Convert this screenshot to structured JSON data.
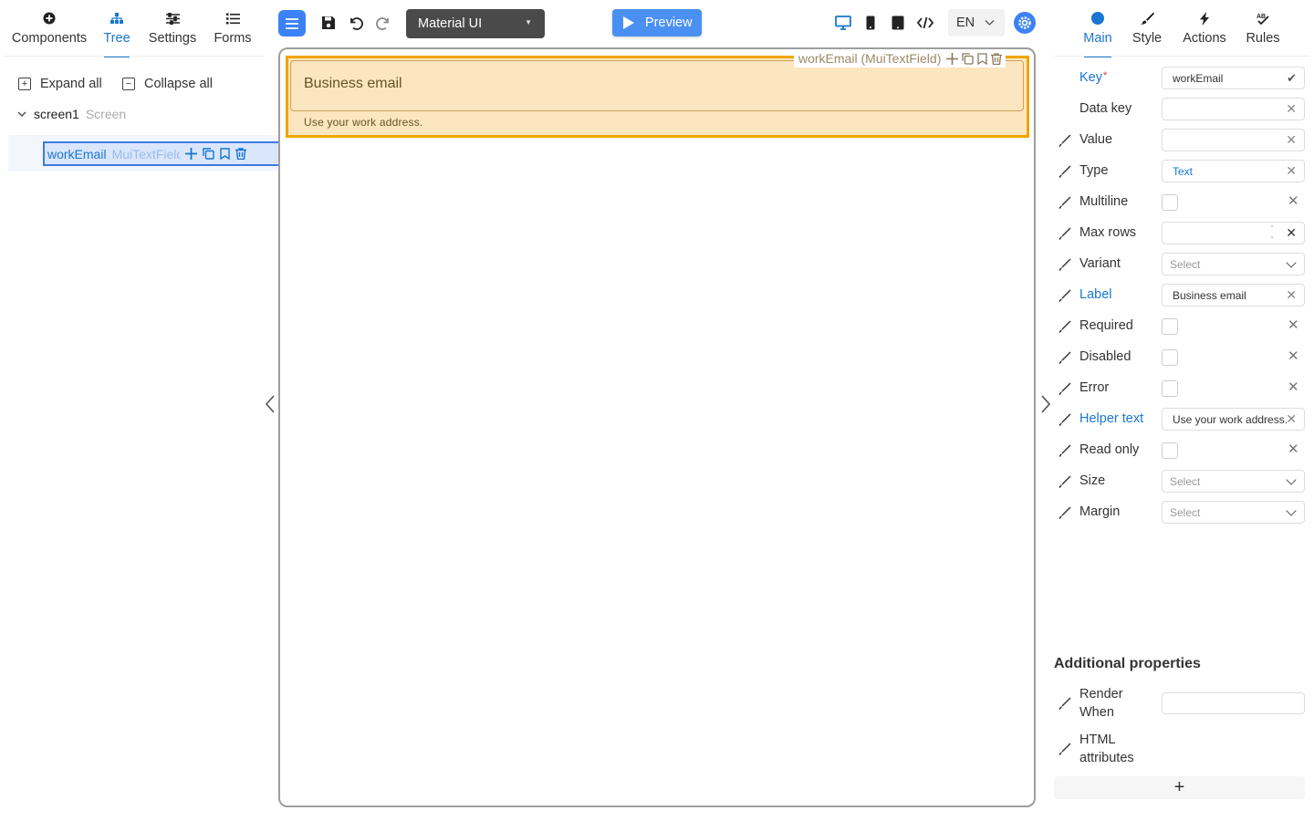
{
  "left_tabs": [
    {
      "label": "Components",
      "icon": "plus-circle-icon"
    },
    {
      "label": "Tree",
      "icon": "tree-icon"
    },
    {
      "label": "Settings",
      "icon": "sliders-icon"
    },
    {
      "label": "Forms",
      "icon": "list-icon"
    }
  ],
  "tree": {
    "expand_all": "Expand all",
    "collapse_all": "Collapse all",
    "screen_key": "screen1",
    "screen_type": "Screen",
    "node_key": "workEmail",
    "node_type": "MuiTextField"
  },
  "toolbar": {
    "library": "Material UI",
    "preview": "Preview",
    "language": "EN"
  },
  "canvas": {
    "field_label": "Business email",
    "field_helper": "Use your work address.",
    "field_tag": "workEmail (MuiTextField)"
  },
  "right_tabs": [
    {
      "label": "Main",
      "icon": "circle-icon"
    },
    {
      "label": "Style",
      "icon": "brush-icon"
    },
    {
      "label": "Actions",
      "icon": "lightning-icon"
    },
    {
      "label": "Rules",
      "icon": "ab-rules-icon"
    }
  ],
  "props": {
    "key": {
      "label": "Key",
      "value": "workEmail"
    },
    "data_key": {
      "label": "Data key",
      "value": ""
    },
    "value": {
      "label": "Value",
      "value": ""
    },
    "type": {
      "label": "Type",
      "value": "Text"
    },
    "multiline": {
      "label": "Multiline"
    },
    "max_rows": {
      "label": "Max rows",
      "value": ""
    },
    "variant": {
      "label": "Variant",
      "placeholder": "Select"
    },
    "label": {
      "label": "Label",
      "value": "Business email"
    },
    "required": {
      "label": "Required"
    },
    "disabled": {
      "label": "Disabled"
    },
    "error": {
      "label": "Error"
    },
    "helper_text": {
      "label": "Helper text",
      "value": "Use your work address."
    },
    "read_only": {
      "label": "Read only"
    },
    "size": {
      "label": "Size",
      "placeholder": "Select"
    },
    "margin": {
      "label": "Margin",
      "placeholder": "Select"
    }
  },
  "additional": {
    "title": "Additional properties",
    "render_when_1": "Render",
    "render_when_2": "When",
    "html_attr_1": "HTML",
    "html_attr_2": "attributes",
    "add": "+"
  },
  "colors": {
    "accent": "#1976d2",
    "selection_orange": "#f0a500",
    "selection_fill": "#fbe6bf",
    "tree_selection": "#3d7be0"
  }
}
